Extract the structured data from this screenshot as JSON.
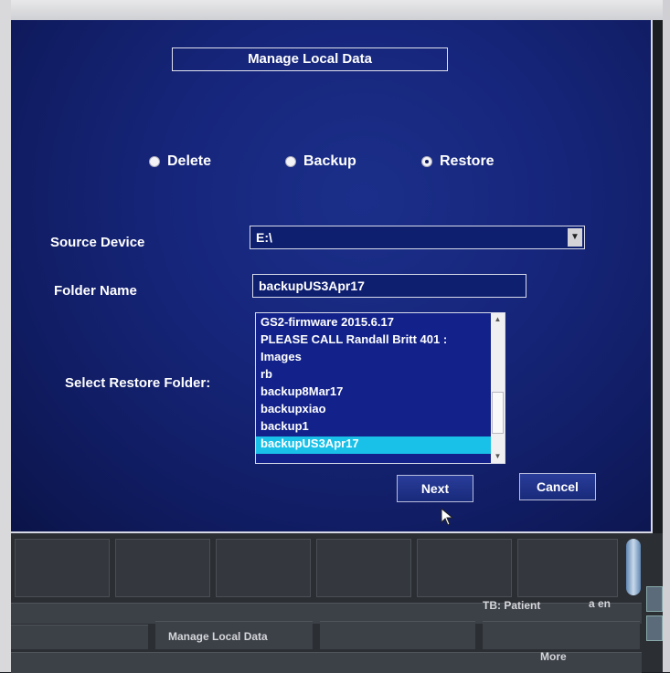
{
  "dialog": {
    "title": "Manage Local Data",
    "modes": [
      {
        "label": "Delete",
        "selected": false
      },
      {
        "label": "Backup",
        "selected": false
      },
      {
        "label": "Restore",
        "selected": true
      }
    ],
    "source_device": {
      "label": "Source Device",
      "value": "E:\\"
    },
    "folder_name": {
      "label": "Folder Name",
      "value": "backupUS3Apr17"
    },
    "restore_folder": {
      "label": "Select Restore Folder:",
      "items": [
        "GS2-firmware 2015.6.17",
        "PLEASE CALL Randall Britt  401 :",
        "Images",
        "rb",
        "backup8Mar17",
        "backupxiao",
        "backup1",
        "backupUS3Apr17"
      ],
      "selected_index": 7
    },
    "buttons": {
      "next": "Next",
      "cancel": "Cancel"
    }
  },
  "bottom_panel": {
    "tb_label": "TB: Patient",
    "tb_extra": "a en",
    "manage_button": "Manage Local Data",
    "more_button": "More"
  },
  "icons": {
    "dropdown": "chevron-down-icon",
    "cursor": "mouse-pointer-icon"
  }
}
